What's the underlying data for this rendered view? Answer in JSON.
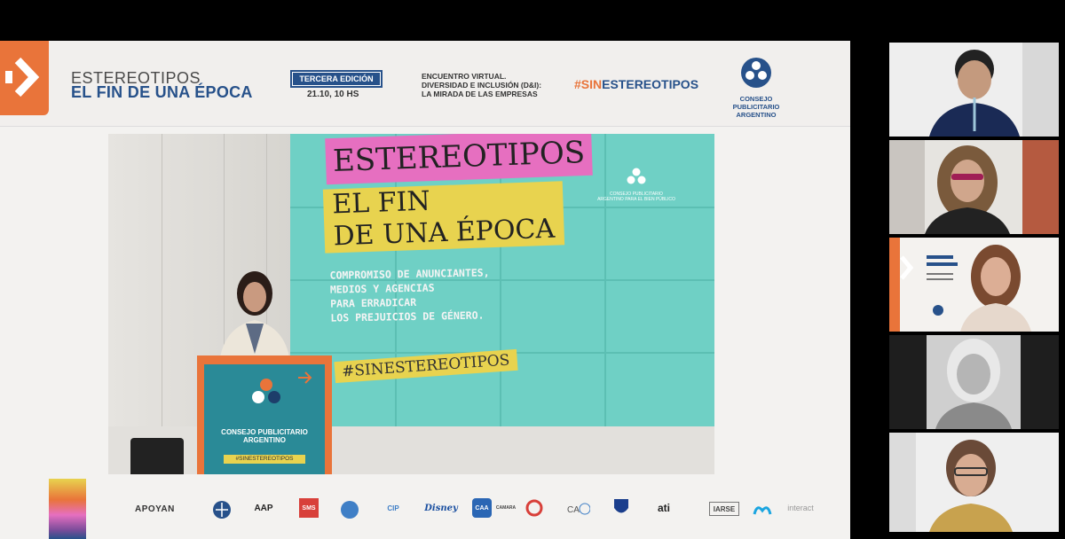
{
  "header": {
    "title_line1": "ESTEREOTIPOS",
    "title_line2": "EL FIN DE UNA ÉPOCA",
    "edition": "TERCERA EDICIÓN",
    "date": "21.10, 10 HS",
    "event_line1": "ENCUENTRO VIRTUAL.",
    "event_line2": "DIVERSIDAD E INCLUSIÓN (D&I):",
    "event_line3": "LA MIRADA DE LAS EMPRESAS",
    "hashtag_prefix": "#SIN",
    "hashtag_suffix": "ESTEREOTIPOS",
    "org_line1": "CONSEJO PUBLICITARIO",
    "org_line2": "ARGENTINO"
  },
  "photo": {
    "screen_word1": "ESTEREOTIPOS",
    "screen_word2a": "EL FIN",
    "screen_word2b": "DE UNA ÉPOCA",
    "screen_body": "COMPROMISO DE ANUNCIANTES,\nMEDIOS Y AGENCIAS\nPARA ERRADICAR\nLOS PREJUICIOS DE GÉNERO.",
    "screen_hashtag": "#SINESTEREOTIPOS",
    "screen_org": "CONSEJO PUBLICITARIO ARGENTINO PARA EL BIEN PÚBLICO",
    "podium_line1": "CONSEJO PUBLICITARIO",
    "podium_line2": "ARGENTINO",
    "podium_hashtag": "#SINESTEREOTIPOS"
  },
  "footer": {
    "apoyan": "APOYAN",
    "sponsors": [
      "AAP",
      "SMS",
      "CIP",
      "Disney",
      "CAA",
      "CAMARA",
      "Unilever",
      "ati",
      "IARSE",
      "interact"
    ]
  },
  "colors": {
    "brand_blue": "#27518a",
    "brand_orange": "#e9743a",
    "screen_teal": "#6fd0c5",
    "pink": "#e66fc0",
    "yellow": "#e8d34f"
  },
  "participants": [
    {
      "id": "participant-1",
      "style": "color"
    },
    {
      "id": "participant-2",
      "style": "color"
    },
    {
      "id": "participant-3",
      "style": "color"
    },
    {
      "id": "participant-4",
      "style": "grayscale"
    },
    {
      "id": "participant-5",
      "style": "color"
    }
  ]
}
